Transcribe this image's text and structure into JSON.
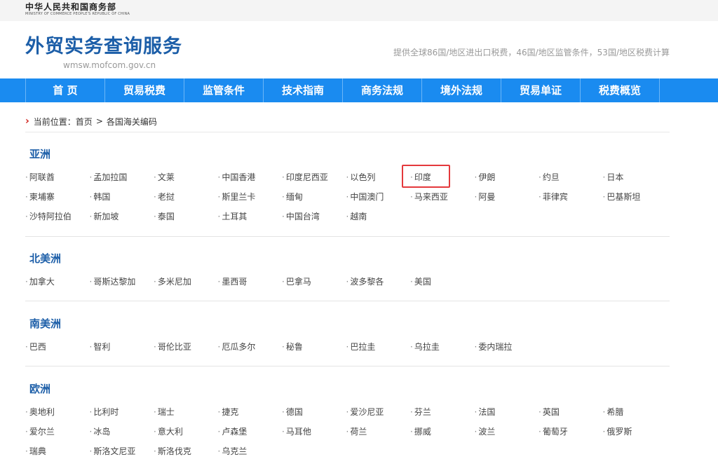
{
  "header": {
    "ministry_cn": "中华人民共和国商务部",
    "ministry_en": "MINISTRY OF COMMERCE PEOPLE'S REPUBLIC OF CHINA",
    "site_title": "外贸实务查询服务",
    "site_url": "wmsw.mofcom.gov.cn",
    "tagline": "提供全球86国/地区进出口税费，46国/地区监管条件，53国/地区税费计算"
  },
  "nav": {
    "items": [
      "首 页",
      "贸易税费",
      "监管条件",
      "技术指南",
      "商务法规",
      "境外法规",
      "贸易单证",
      "税费概览"
    ]
  },
  "breadcrumb": {
    "prefix": "当前位置：",
    "home": "首页",
    "separator": ">",
    "current": "各国海关编码"
  },
  "regions": [
    {
      "title": "亚洲",
      "countries": [
        "阿联酋",
        "孟加拉国",
        "文莱",
        "中国香港",
        "印度尼西亚",
        "以色列",
        "印度",
        "伊朗",
        "约旦",
        "日本",
        "柬埔寨",
        "韩国",
        "老挝",
        "斯里兰卡",
        "缅甸",
        "中国澳门",
        "马来西亚",
        "阿曼",
        "菲律宾",
        "巴基斯坦",
        "沙特阿拉伯",
        "新加坡",
        "泰国",
        "土耳其",
        "中国台湾",
        "越南"
      ]
    },
    {
      "title": "北美洲",
      "countries": [
        "加拿大",
        "哥斯达黎加",
        "多米尼加",
        "墨西哥",
        "巴拿马",
        "波多黎各",
        "美国"
      ]
    },
    {
      "title": "南美洲",
      "countries": [
        "巴西",
        "智利",
        "哥伦比亚",
        "厄瓜多尔",
        "秘鲁",
        "巴拉圭",
        "乌拉圭",
        "委内瑞拉"
      ]
    },
    {
      "title": "欧洲",
      "countries": [
        "奥地利",
        "比利时",
        "瑞士",
        "捷克",
        "德国",
        "爱沙尼亚",
        "芬兰",
        "法国",
        "英国",
        "希腊",
        "爱尔兰",
        "冰岛",
        "意大利",
        "卢森堡",
        "马耳他",
        "荷兰",
        "挪威",
        "波兰",
        "葡萄牙",
        "俄罗斯",
        "瑞典",
        "斯洛文尼亚",
        "斯洛伐克",
        "乌克兰"
      ]
    }
  ],
  "bullet": "·",
  "colors": {
    "nav_bg": "#1a8bf0",
    "title_blue": "#1c5ea8",
    "breadcrumb_arrow": "#d0201a",
    "highlight": "#e4393c"
  }
}
